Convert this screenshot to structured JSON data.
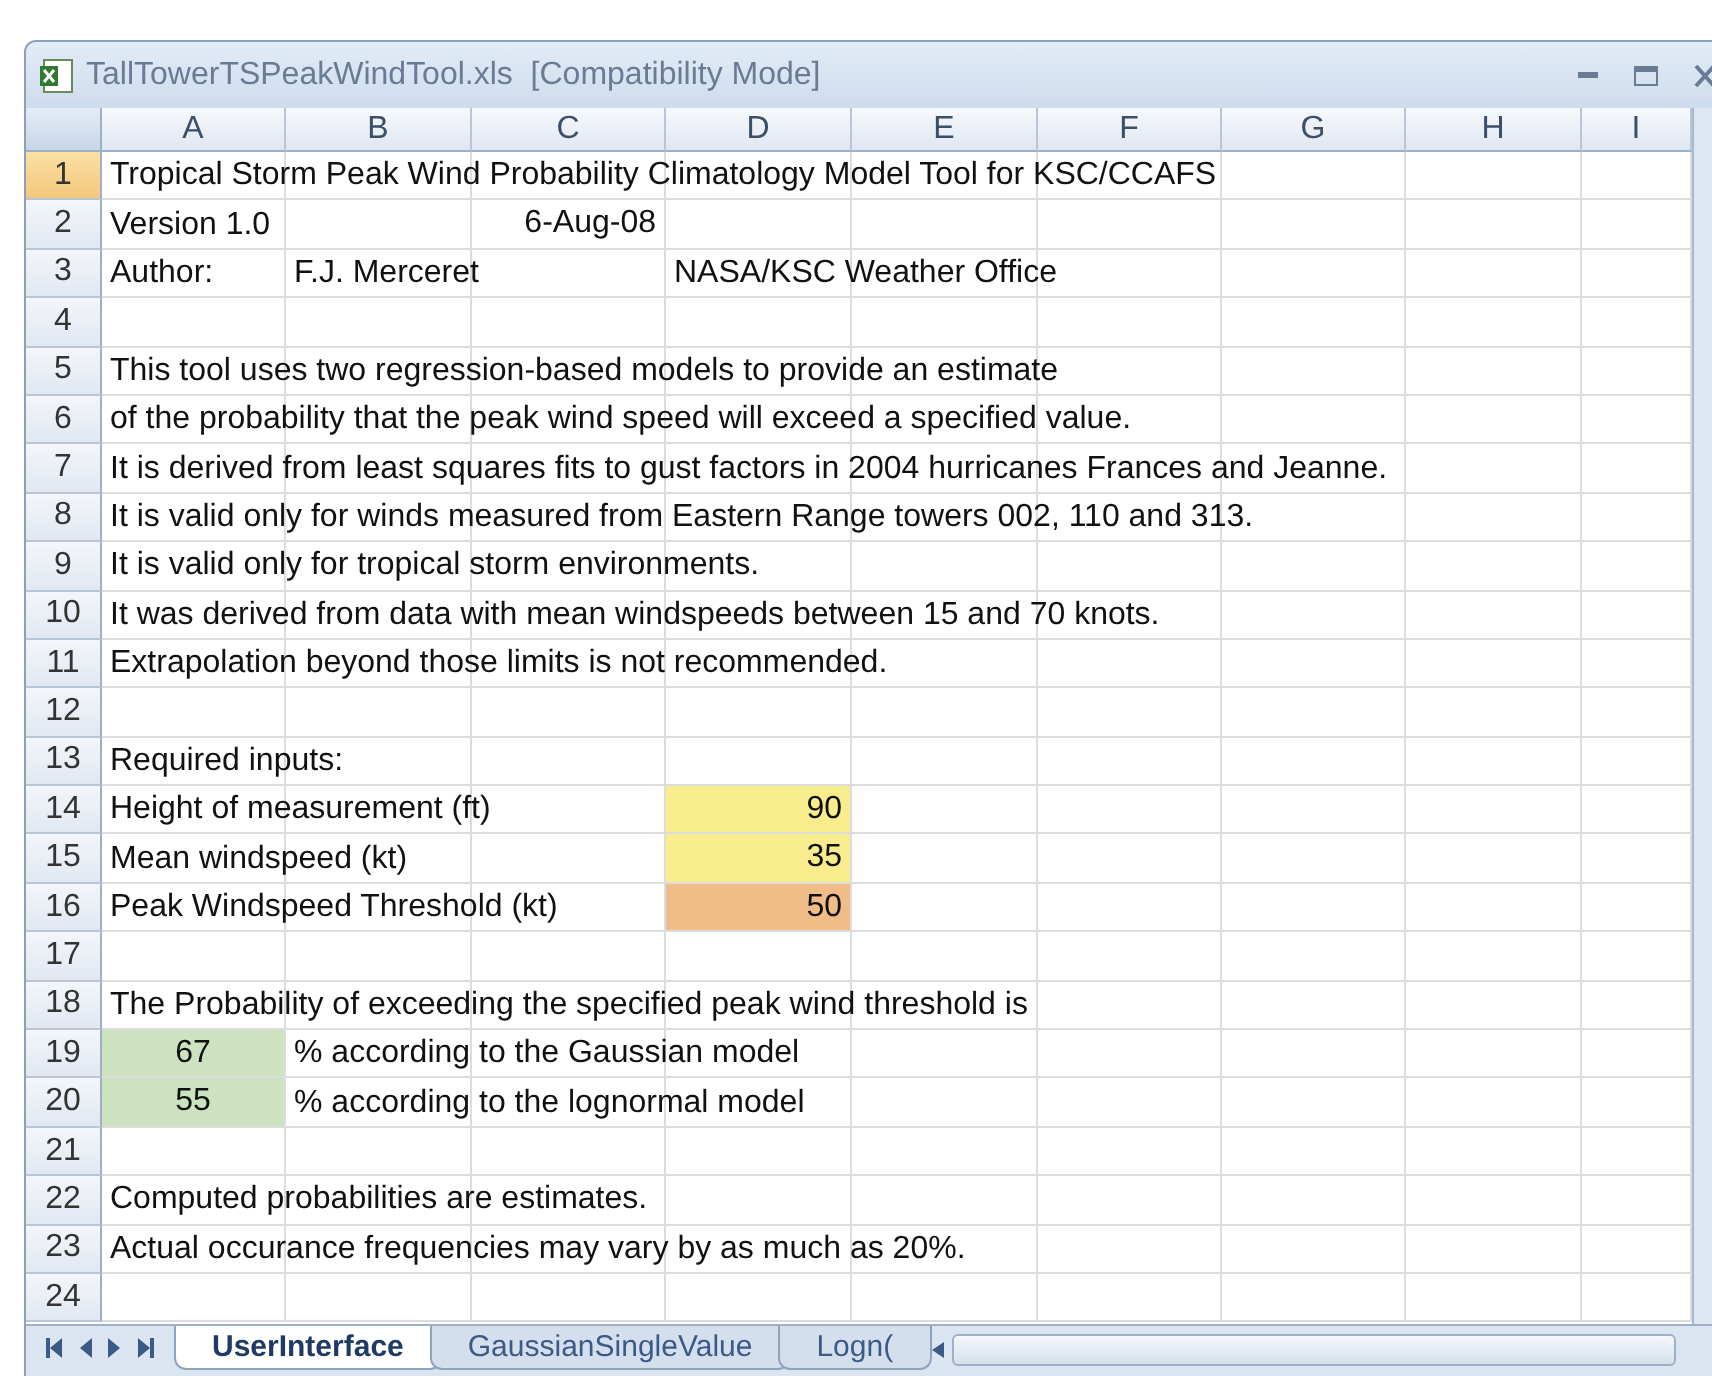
{
  "window": {
    "title": "TallTowerTSPeakWindTool.xls  [Compatibility Mode]"
  },
  "columns": [
    {
      "label": "A"
    },
    {
      "label": "B"
    },
    {
      "label": "C"
    },
    {
      "label": "D"
    },
    {
      "label": "E"
    },
    {
      "label": "F"
    },
    {
      "label": "G"
    },
    {
      "label": "H"
    },
    {
      "label": "I"
    }
  ],
  "rows": [
    {
      "number": "1",
      "selected": true,
      "a": "Tropical Storm Peak Wind Probability Climatology Model Tool for KSC/CCAFS"
    },
    {
      "number": "2",
      "selected": false,
      "a": "Version 1.0",
      "c": {
        "value": "6-Aug-08",
        "centered": false
      }
    },
    {
      "number": "3",
      "selected": false,
      "a": "Author:",
      "b": "F.J. Merceret",
      "d": "NASA/KSC Weather Office"
    },
    {
      "number": "4",
      "selected": false
    },
    {
      "number": "5",
      "selected": false,
      "a": "This tool uses two regression-based models to provide an estimate"
    },
    {
      "number": "6",
      "selected": false,
      "a": "of the probability that the peak wind speed will exceed a specified value."
    },
    {
      "number": "7",
      "selected": false,
      "a": "It is derived from least squares fits to gust factors in 2004 hurricanes Frances and Jeanne."
    },
    {
      "number": "8",
      "selected": false,
      "a": "It is valid only for winds measured from Eastern Range towers 002, 110 and 313."
    },
    {
      "number": "9",
      "selected": false,
      "a": "It is valid only for tropical storm environments."
    },
    {
      "number": "10",
      "selected": false,
      "a": "It was derived from data with mean windspeeds between 15 and 70 knots."
    },
    {
      "number": "11",
      "selected": false,
      "a": "Extrapolation beyond those limits is not recommended."
    },
    {
      "number": "12",
      "selected": false
    },
    {
      "number": "13",
      "selected": false,
      "a": "Required inputs:"
    },
    {
      "number": "14",
      "selected": false,
      "a": "Height of measurement (ft)",
      "d": {
        "value": "90",
        "centered": false,
        "color": "#f8ec8c"
      }
    },
    {
      "number": "15",
      "selected": false,
      "a": "Mean windspeed (kt)",
      "d": {
        "value": "35",
        "centered": false,
        "color": "#f8ec8c"
      }
    },
    {
      "number": "16",
      "selected": false,
      "a": "Peak Windspeed Threshold (kt)",
      "d": {
        "value": "50",
        "centered": false,
        "color": "#f0bc88"
      }
    },
    {
      "number": "17",
      "selected": false
    },
    {
      "number": "18",
      "selected": false,
      "a": "The Probability of exceeding the specified peak wind threshold is"
    },
    {
      "number": "19",
      "selected": false,
      "a": {
        "value": "67",
        "centered": true,
        "color": "#cde3bf"
      },
      "b": "% according to the Gaussian model"
    },
    {
      "number": "20",
      "selected": false,
      "a": {
        "value": "55",
        "centered": true,
        "color": "#cde3bf"
      },
      "b": "% according to the lognormal model"
    },
    {
      "number": "21",
      "selected": false
    },
    {
      "number": "22",
      "selected": false,
      "a": "Computed probabilities are estimates."
    },
    {
      "number": "23",
      "selected": false,
      "a": "Actual occurance frequencies may vary by as much as 20%."
    },
    {
      "number": "24",
      "selected": false
    }
  ],
  "sheet_tabs": [
    {
      "label": "UserInterface",
      "selected": true
    },
    {
      "label": "GaussianSingleValue",
      "selected": false
    },
    {
      "label": "Logn(",
      "selected": false
    }
  ]
}
